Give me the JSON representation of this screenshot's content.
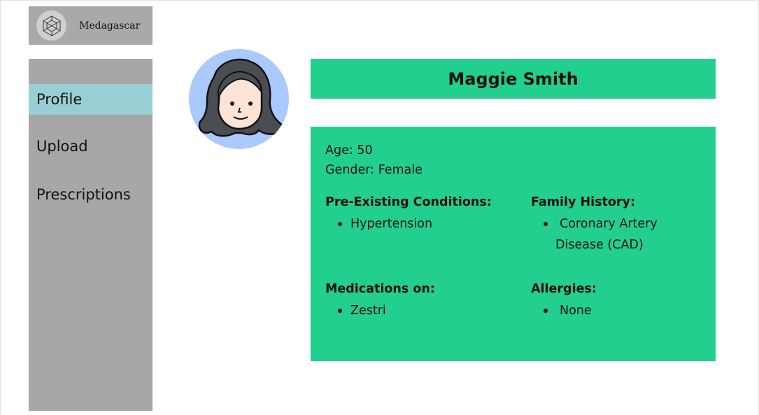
{
  "app": {
    "brand_name": "Medagascar",
    "logo_icon": "geometric-cube-logo-icon"
  },
  "sidebar": {
    "items": [
      {
        "label": "Profile",
        "active": true
      },
      {
        "label": "Upload",
        "active": false
      },
      {
        "label": "Prescriptions",
        "active": false
      }
    ]
  },
  "patient": {
    "avatar_icon": "woman-avatar-icon",
    "name": "Maggie Smith",
    "age_text": "Age: 50",
    "gender_text": "Gender: Female",
    "pre_existing_title": "Pre-Existing Conditions:",
    "pre_existing": [
      "Hypertension"
    ],
    "family_history_title": "Family History:",
    "family_history": [
      "Coronary Artery Disease (CAD)"
    ],
    "medications_title": "Medications on:",
    "medications": [
      "Zestri"
    ],
    "allergies_title": "Allergies:",
    "allergies": [
      "None"
    ]
  },
  "colors": {
    "accent_green": "#23cf8d",
    "sidebar_gray": "#a7a7a7",
    "active_item": "#98cfd4",
    "avatar_bg": "#a9c9ff"
  }
}
